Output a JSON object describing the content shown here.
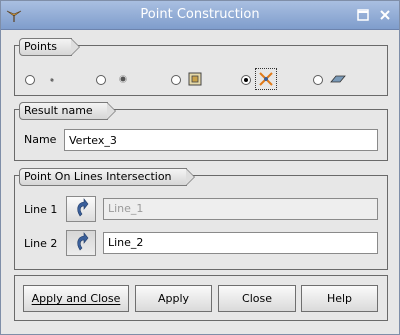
{
  "window": {
    "title": "Point Construction",
    "maximize_icon": "maximize-icon",
    "close_icon": "close-icon"
  },
  "points": {
    "title": "Points",
    "options": [
      {
        "icon": "point-small-icon",
        "checked": false
      },
      {
        "icon": "point-dot-icon",
        "checked": false
      },
      {
        "icon": "point-on-face-icon",
        "checked": false
      },
      {
        "icon": "lines-intersection-icon",
        "checked": true
      },
      {
        "icon": "point-on-surface-icon",
        "checked": false
      }
    ]
  },
  "result": {
    "title": "Result name",
    "name_label": "Name",
    "name_value": "Vertex_3"
  },
  "intersection": {
    "title": "Point On Lines Intersection",
    "line1_label": "Line 1",
    "line1_value": "Line_1",
    "line2_label": "Line 2",
    "line2_value": "Line_2",
    "select_icon": "arrow-select-icon"
  },
  "buttons": {
    "apply_close": "Apply and Close",
    "apply": "Apply",
    "close": "Close",
    "help": "Help"
  },
  "colors": {
    "titlebar": "#8aa6d4",
    "accent": "#e07a18",
    "select_arrow": "#3a5f9a"
  }
}
